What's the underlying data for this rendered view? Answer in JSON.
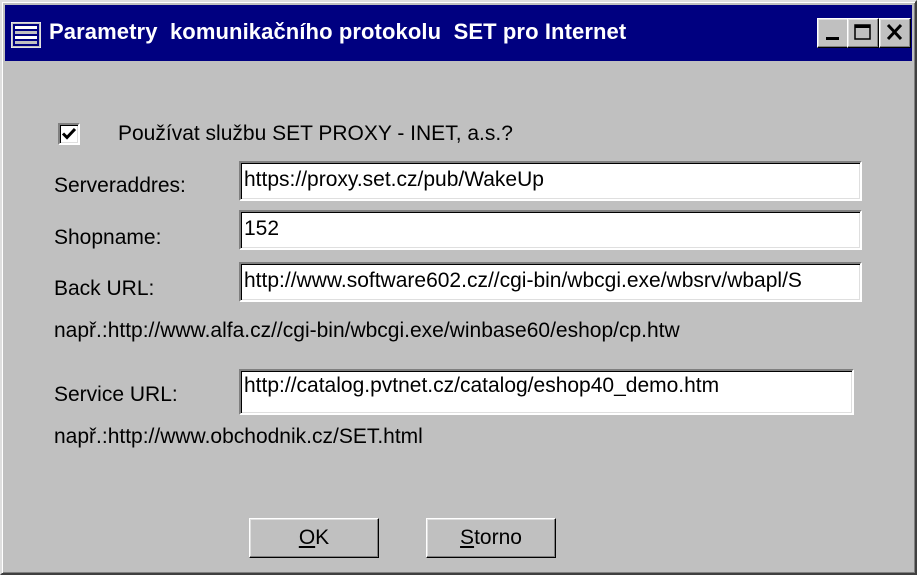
{
  "window": {
    "title": "Parametry  komunikačního protokolu  SET pro Internet",
    "title_icon": "dialog-icon",
    "controls": [
      "minimize-icon",
      "maximize-icon",
      "close-icon"
    ],
    "colors": {
      "titlebar": "#000080",
      "face": "#c0c0c0"
    }
  },
  "form": {
    "use_proxy": {
      "checked": true,
      "label": "Používat službu SET PROXY - INET, a.s.?"
    },
    "server_address": {
      "label": "Serveraddres:",
      "value": "https://proxy.set.cz/pub/WakeUp"
    },
    "shop_name": {
      "label": "Shopname:",
      "value": "152"
    },
    "back_url": {
      "label": "Back URL:",
      "value": "http://www.software602.cz//cgi-bin/wbcgi.exe/wbsrv/wbapl/S",
      "hint": "např.:http://www.alfa.cz//cgi-bin/wbcgi.exe/winbase60/eshop/cp.htw"
    },
    "service_url": {
      "label": "Service URL:",
      "value": "http://catalog.pvtnet.cz/catalog/eshop40_demo.htm",
      "hint": "např.:http://www.obchodnik.cz/SET.html"
    }
  },
  "buttons": {
    "ok": {
      "mnemonic": "O",
      "rest": "K"
    },
    "cancel": {
      "mnemonic": "S",
      "rest": "torno"
    }
  }
}
